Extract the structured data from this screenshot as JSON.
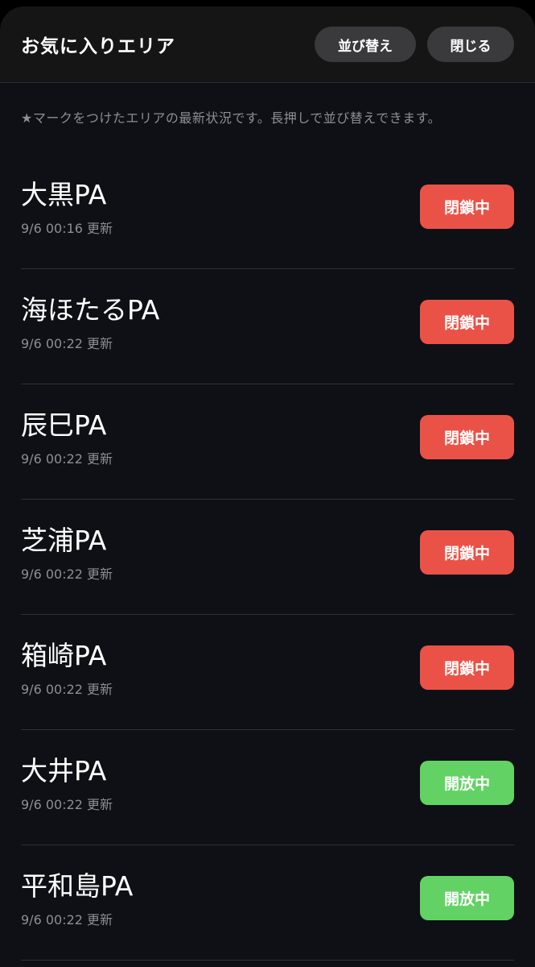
{
  "header": {
    "title": "お気に入りエリア",
    "sort_label": "並び替え",
    "close_label": "閉じる"
  },
  "description": "★マークをつけたエリアの最新状況です。長押しで並び替えできます。",
  "colors": {
    "closed": "#ea5247",
    "open": "#62d264",
    "background": "#0e1016",
    "header_bg": "#151515",
    "button_bg": "#3a3a3c"
  },
  "areas": [
    {
      "name": "大黒PA",
      "updated": "9/6 00:16 更新",
      "status": "閉鎖中",
      "state": "closed"
    },
    {
      "name": "海ほたるPA",
      "updated": "9/6 00:22 更新",
      "status": "閉鎖中",
      "state": "closed"
    },
    {
      "name": "辰巳PA",
      "updated": "9/6 00:22 更新",
      "status": "閉鎖中",
      "state": "closed"
    },
    {
      "name": "芝浦PA",
      "updated": "9/6 00:22 更新",
      "status": "閉鎖中",
      "state": "closed"
    },
    {
      "name": "箱崎PA",
      "updated": "9/6 00:22 更新",
      "status": "閉鎖中",
      "state": "closed"
    },
    {
      "name": "大井PA",
      "updated": "9/6 00:22 更新",
      "status": "開放中",
      "state": "open"
    },
    {
      "name": "平和島PA",
      "updated": "9/6 00:22 更新",
      "status": "開放中",
      "state": "open"
    }
  ]
}
